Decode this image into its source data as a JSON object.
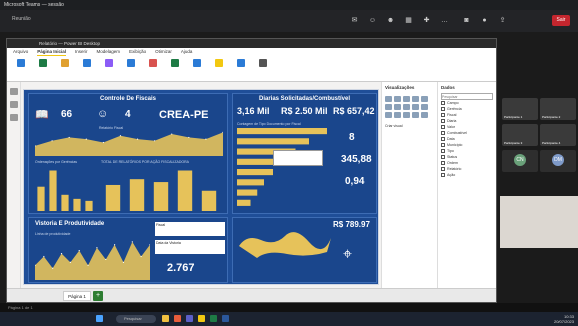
{
  "browser": {
    "title": "Microsoft Teams — sessão"
  },
  "meet": {
    "title": "Reunião",
    "leave_label": "Sair"
  },
  "pbi": {
    "window_title": "Relatório — Power BI Desktop",
    "tabs": [
      "Arquivo",
      "Página Inicial",
      "Inserir",
      "Modelagem",
      "Exibição",
      "Otimizar",
      "Ajuda"
    ],
    "active_tab": "Página Inicial",
    "page_tab": "Página 1"
  },
  "dashboard": {
    "panel1_title": "Controle De Fiscais",
    "kpi1": "66",
    "kpi2": "4",
    "kpi3": "8",
    "logo_text": "CREA-PE",
    "sub_chart_label": "Relatório Fiscal",
    "orders_label": "Ordenações por Gerências",
    "plates_label": "TOTAL DE RELATÓRIOS POR AÇÃO FISCALIZADORA",
    "panel2_title": "Diarias Solicitadas/Combustível",
    "kpi_diarias": "3,16 Mil",
    "kpi_valor": "R$ 2.50 Mil",
    "kpi_comb": "R$ 657,42",
    "tipo_label": "Contagem de Tipo Documento por Fiscal",
    "kpi_8": "8",
    "kpi_345": "345,88",
    "kpi_094": "0,94",
    "kpi_total": "R$ 789.97",
    "panel3_title": "Vistoria E Produtividade",
    "line_label": "Linha de produtividade",
    "fiscal_label": "Fiscal",
    "data_label": "Data da Vistoria",
    "kpi_2767": "2.767"
  },
  "visualizations": {
    "title": "Visualizações",
    "section": "Criar visual"
  },
  "data_pane": {
    "title": "Dados",
    "search_placeholder": "Pesquisar",
    "fields": [
      "Campo",
      "Gerência",
      "Fiscal",
      "Diaria",
      "Valor",
      "Combustível",
      "Data",
      "Município",
      "Tipo",
      "Status",
      "Ordem",
      "Relatório",
      "Ação"
    ]
  },
  "participants": [
    {
      "name": "Participante 1"
    },
    {
      "name": "Participante 2"
    },
    {
      "name": "Participante 3"
    },
    {
      "name": "Participante 4"
    },
    {
      "name": "CN"
    },
    {
      "name": "DM"
    }
  ],
  "taskbar": {
    "search": "Pesquisar",
    "time": "10:33",
    "date": "20/07/2023"
  },
  "statusbar": {
    "text": "Página 1 de 1"
  },
  "chart_data": [
    {
      "type": "area",
      "x": [
        1,
        2,
        3,
        4,
        5,
        6,
        7,
        8,
        9,
        10,
        11,
        12
      ],
      "values": [
        6,
        9,
        11,
        10,
        8,
        12,
        10,
        9,
        13,
        11,
        10,
        14
      ]
    },
    {
      "type": "bar",
      "categories": [
        "",
        "",
        "",
        "",
        ""
      ],
      "values": [
        12,
        20,
        8,
        6,
        5
      ]
    },
    {
      "type": "bar",
      "categories": [
        "",
        "",
        "",
        "",
        ""
      ],
      "values": [
        9,
        11,
        10,
        14,
        7
      ]
    },
    {
      "type": "bar",
      "categories": [
        "",
        "",
        "",
        "",
        "",
        "",
        "",
        ""
      ],
      "values": [
        40,
        32,
        26,
        20,
        16,
        12,
        9,
        6
      ]
    },
    {
      "type": "area",
      "x": [
        1,
        2,
        3,
        4,
        5,
        6,
        7,
        8,
        9,
        10,
        11,
        12,
        13,
        14
      ],
      "values": [
        5,
        8,
        4,
        9,
        6,
        10,
        5,
        11,
        7,
        12,
        6,
        13,
        8,
        12
      ]
    }
  ]
}
